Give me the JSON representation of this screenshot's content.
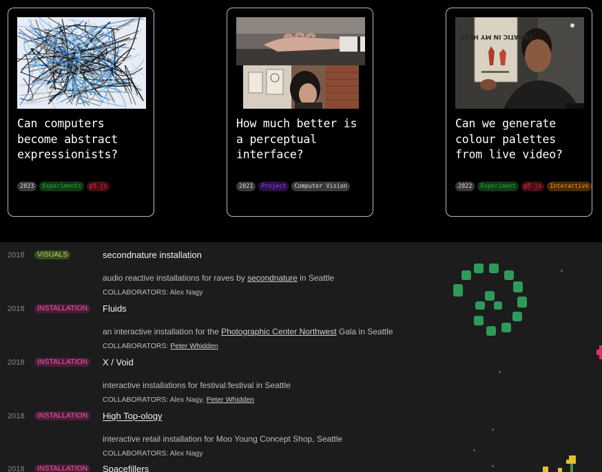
{
  "cards": [
    {
      "title": "Can computers become abstract expressionists?",
      "tags": [
        {
          "label": "2023",
          "style": "year"
        },
        {
          "label": "Experiments",
          "style": "green"
        },
        {
          "label": "p5.js",
          "style": "red"
        }
      ]
    },
    {
      "title": "How much better is a perceptual interface?",
      "tags": [
        {
          "label": "2021",
          "style": "year"
        },
        {
          "label": "Project",
          "style": "purple"
        },
        {
          "label": "Computer Vision",
          "style": "grey"
        }
      ]
    },
    {
      "title": "Can we generate colour palettes from live video?",
      "tags": [
        {
          "label": "2022",
          "style": "year"
        },
        {
          "label": "Experiment",
          "style": "green"
        },
        {
          "label": "p5.js",
          "style": "red"
        },
        {
          "label": "Interactive",
          "style": "orange"
        }
      ]
    }
  ],
  "book_cover_text": "LUNATIC IN MY HEAD",
  "projects": [
    {
      "year": "2018",
      "category": "VISUALS",
      "title": "secondnature installation",
      "desc_before": "audio reactive installations for raves by ",
      "desc_link": "secondnature",
      "desc_after": " in Seattle",
      "collab_label": "COLLABORATORS:",
      "collab_plain": " Alex Nagy",
      "collab_link": "",
      "collab_sep": ""
    },
    {
      "year": "2018",
      "category": "INSTALLATION",
      "title": "Fluids",
      "desc_before": "an interactive installation for the ",
      "desc_link": "Photographic Center Northwest",
      "desc_after": " Gala in Seattle",
      "collab_label": "COLLABORATORS:",
      "collab_plain": " ",
      "collab_link": "Peter Whidden",
      "collab_sep": ""
    },
    {
      "year": "2018",
      "category": "INSTALLATION",
      "title": "X / Void",
      "desc_before": "interactive installations for festival:festival in Seattle",
      "desc_link": "",
      "desc_after": "",
      "collab_label": "COLLABORATORS:",
      "collab_plain": " Alex Nagy, ",
      "collab_link": "Peter Whidden",
      "collab_sep": ""
    },
    {
      "year": "2018",
      "category": "INSTALLATION",
      "title": "High Top-ology",
      "desc_before": "interactive retail installation for Moo Young Concept Shop, Seattle",
      "desc_link": "",
      "desc_after": "",
      "collab_label": "COLLABORATORS:",
      "collab_plain": " Alex Nagy",
      "collab_link": "",
      "collab_sep": ""
    },
    {
      "year": "2018",
      "category": "INSTALLATION",
      "title": "Spacefillers",
      "desc_before": "",
      "desc_link": "",
      "desc_after": "",
      "collab_label": "",
      "collab_plain": "",
      "collab_link": "",
      "collab_sep": ""
    }
  ],
  "colors": {
    "accent_green": "#2e9a5a",
    "tag_green": "#2fa93a",
    "tag_red": "#e0304a",
    "tag_purple": "#9b40f0",
    "tag_orange": "#f19a20",
    "category_pink": "#f05aa8",
    "category_olive": "#b8d46a"
  }
}
